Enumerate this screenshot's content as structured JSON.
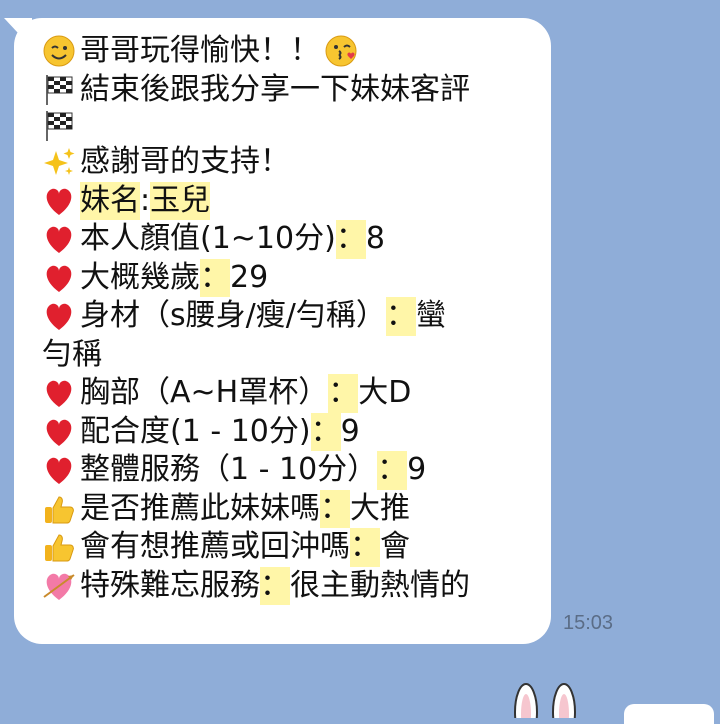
{
  "message": {
    "lines": [
      {
        "icon": "wink-face-icon",
        "segments": [
          {
            "text": "哥哥玩得愉快！！",
            "hl": false
          }
        ],
        "trailing_icon": "kiss-face-icon"
      },
      {
        "icon": "checkered-flag-icon",
        "segments": [
          {
            "text": "結束後跟我分享一下妹妹客評",
            "hl": false
          }
        ]
      },
      {
        "icon": "checkered-flag-icon",
        "segments": [
          {
            "text": "",
            "hl": false
          }
        ]
      },
      {
        "icon": "sparkles-icon",
        "segments": [
          {
            "text": "感謝哥的支持！",
            "hl": false
          }
        ]
      },
      {
        "icon": "red-heart-icon",
        "segments": [
          {
            "text": "妹名",
            "hl": true
          },
          {
            "text": ":",
            "hl": false
          },
          {
            "text": "玉兒",
            "hl": true
          }
        ]
      },
      {
        "icon": "red-heart-icon",
        "segments": [
          {
            "text": "本人顏值(1~10分)",
            "hl": false
          },
          {
            "text": "：",
            "hl": true
          },
          {
            "text": "8",
            "hl": false
          }
        ]
      },
      {
        "icon": "red-heart-icon",
        "segments": [
          {
            "text": "大概幾歲",
            "hl": false
          },
          {
            "text": "：",
            "hl": true
          },
          {
            "text": "29",
            "hl": false
          }
        ]
      },
      {
        "icon": "red-heart-icon",
        "segments": [
          {
            "text": "身材（s腰身/瘦/勻稱）",
            "hl": false
          },
          {
            "text": "：",
            "hl": true
          },
          {
            "text": "蠻",
            "hl": false
          }
        ]
      },
      {
        "icon": "",
        "segments": [
          {
            "text": "勻稱",
            "hl": false
          }
        ]
      },
      {
        "icon": "red-heart-icon",
        "segments": [
          {
            "text": "胸部（A~H罩杯）",
            "hl": false
          },
          {
            "text": "：",
            "hl": true
          },
          {
            "text": "大D",
            "hl": false
          }
        ]
      },
      {
        "icon": "red-heart-icon",
        "segments": [
          {
            "text": "配合度(1 - 10分)",
            "hl": false
          },
          {
            "text": "：",
            "hl": true
          },
          {
            "text": "9",
            "hl": false
          }
        ]
      },
      {
        "icon": "red-heart-icon",
        "segments": [
          {
            "text": "整體服務（1 - 10分）",
            "hl": false
          },
          {
            "text": "：",
            "hl": true
          },
          {
            "text": "9",
            "hl": false
          }
        ]
      },
      {
        "icon": "thumbs-up-icon",
        "segments": [
          {
            "text": "是否推薦此妹妹嗎",
            "hl": false
          },
          {
            "text": "：",
            "hl": true
          },
          {
            "text": "大推",
            "hl": false
          }
        ]
      },
      {
        "icon": "thumbs-up-icon",
        "segments": [
          {
            "text": "會有想推薦或回沖嗎",
            "hl": false
          },
          {
            "text": "：",
            "hl": true
          },
          {
            "text": "會",
            "hl": false
          }
        ]
      },
      {
        "icon": "heart-with-arrow-icon",
        "segments": [
          {
            "text": "特殊難忘服務",
            "hl": false
          },
          {
            "text": "：",
            "hl": true
          },
          {
            "text": "很主動熱情的",
            "hl": false
          }
        ]
      }
    ],
    "timestamp": "15:03"
  },
  "colors": {
    "background": "#8fadd8",
    "bubble": "#ffffff",
    "highlight": "#fff6a8",
    "heart": "#e0202e"
  }
}
